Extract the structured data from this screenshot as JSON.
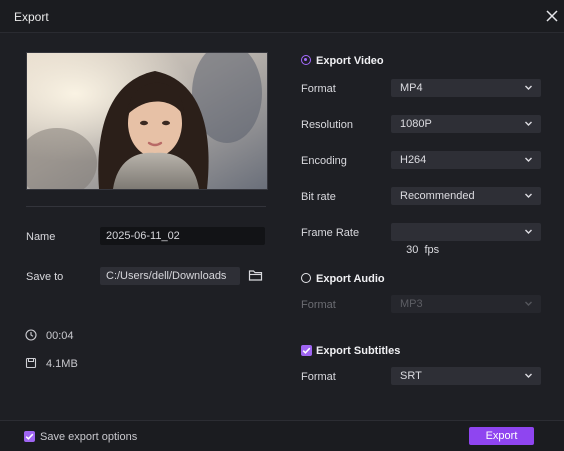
{
  "window": {
    "title": "Export"
  },
  "preview": {
    "image_alt": "Video preview thumbnail"
  },
  "name": {
    "label": "Name",
    "value": "2025-06-11_02"
  },
  "save_to": {
    "label": "Save to",
    "value": "C:/Users/dell/Downloads"
  },
  "info": {
    "duration": "00:04",
    "size": "4.1MB"
  },
  "export_video": {
    "label": "Export Video",
    "selected": true,
    "rows": [
      {
        "label": "Format",
        "value": "MP4"
      },
      {
        "label": "Resolution",
        "value": "1080P"
      },
      {
        "label": "Encoding",
        "value": "H264"
      },
      {
        "label": "Bit rate",
        "value": "Recommended"
      },
      {
        "label": "Frame Rate",
        "value": "30  fps"
      }
    ]
  },
  "export_audio": {
    "label": "Export Audio",
    "selected": false,
    "format_label": "Format",
    "format_value": "MP3"
  },
  "export_subtitles": {
    "label": "Export Subtitles",
    "checked": true,
    "format_label": "Format",
    "format_value": "SRT"
  },
  "footer": {
    "save_options_label": "Save export options",
    "save_options_checked": true,
    "export_button": "Export"
  },
  "colors": {
    "accent": "#9f65f2",
    "button": "#8f45f0",
    "background": "#1e1f24"
  }
}
